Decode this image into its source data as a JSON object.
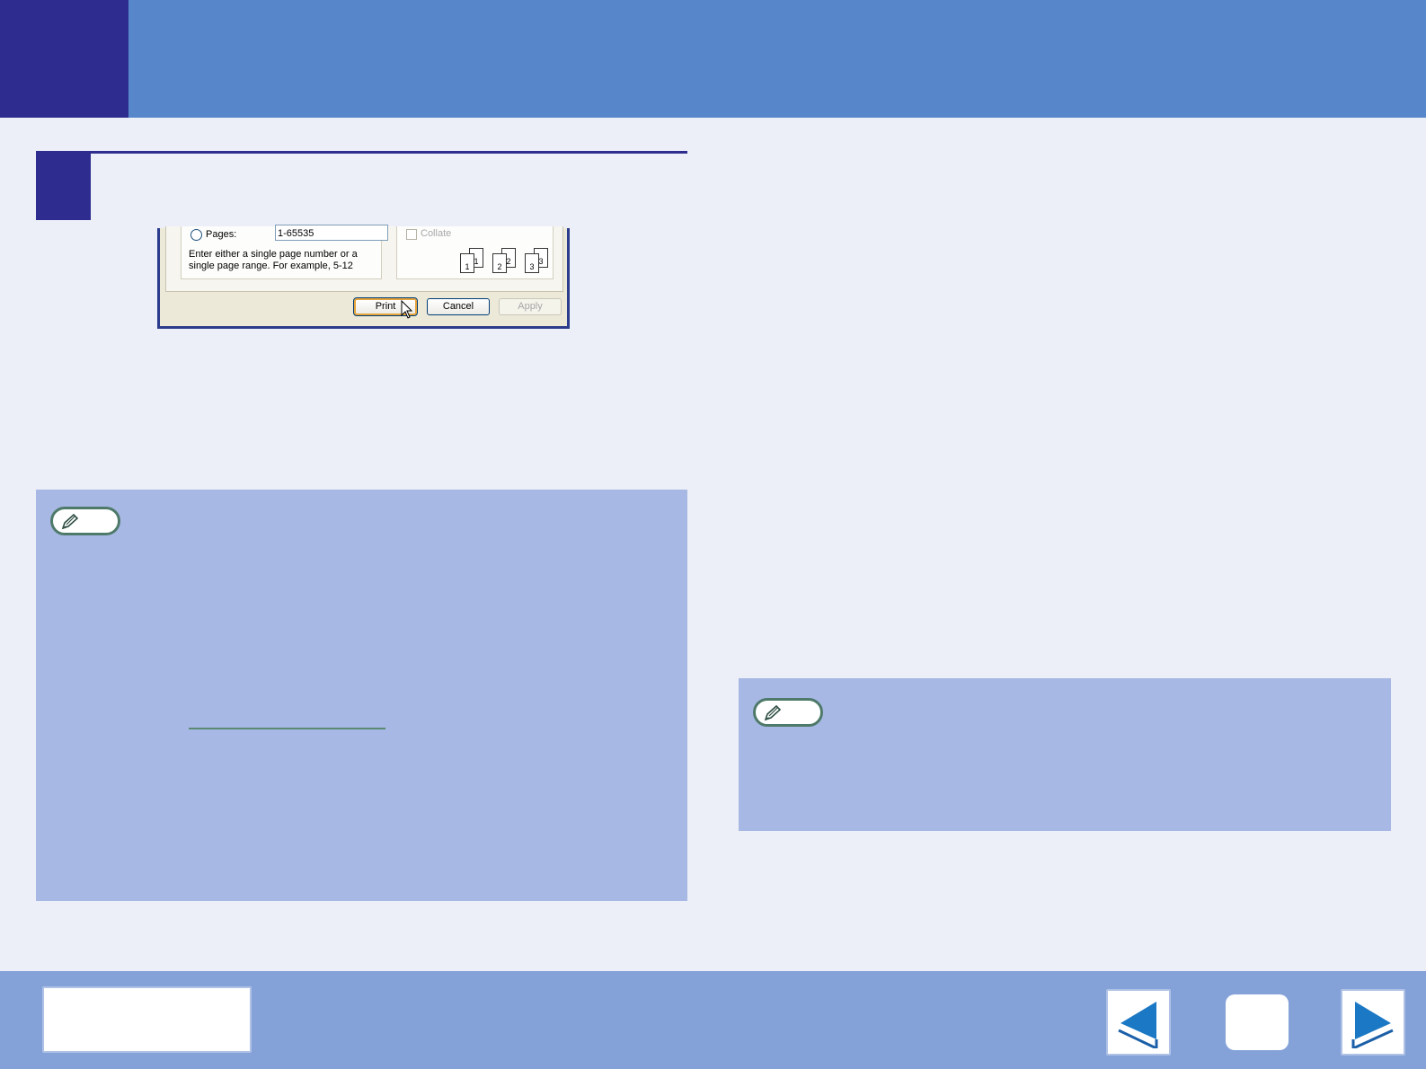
{
  "dialog": {
    "pages_label": "Pages:",
    "pages_value": "1-65535",
    "pages_hint": "Enter either a single page number or a single page range.  For example, 5-12",
    "collate_label": "Collate",
    "sheets": [
      "1",
      "1",
      "2",
      "2",
      "3",
      "3"
    ],
    "buttons": {
      "print": "Print",
      "cancel": "Cancel",
      "apply": "Apply"
    }
  },
  "icons": {
    "note": "pencil-icon",
    "back": "back-arrow-icon",
    "forward": "forward-arrow-icon"
  },
  "colors": {
    "header": "#5787CA",
    "header_block": "#2E2D8F",
    "background": "#ECEFF8",
    "note_panel": "#A8B8E4",
    "footer": "#84A2D8"
  }
}
